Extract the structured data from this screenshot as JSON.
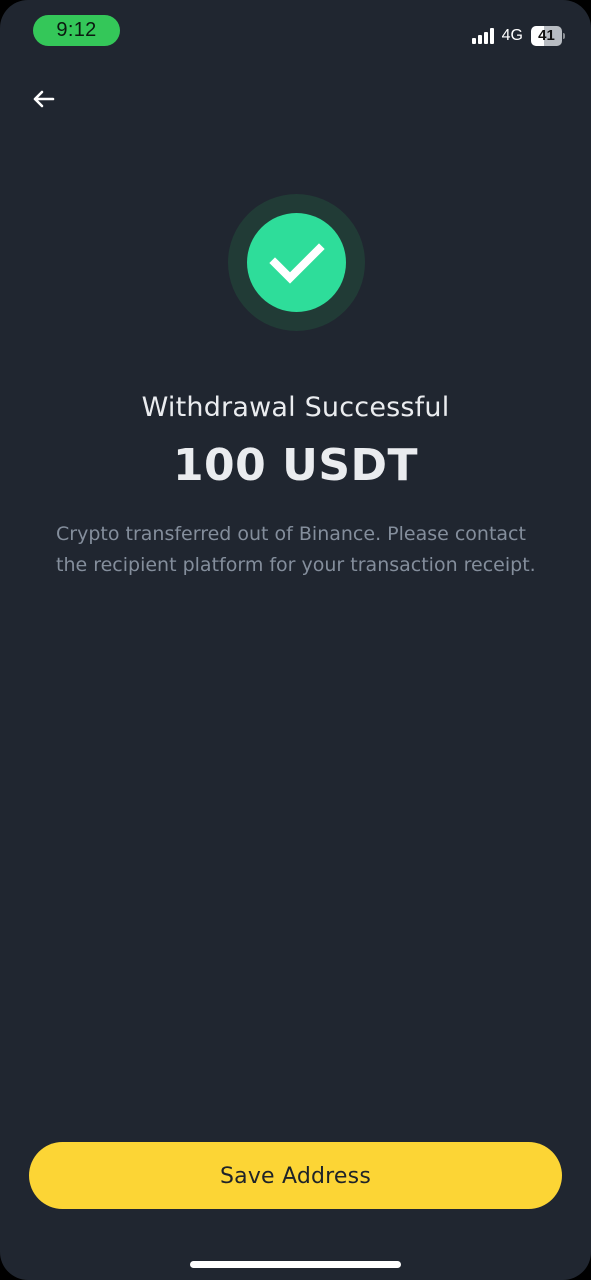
{
  "status_bar": {
    "time": "9:12",
    "network": "4G",
    "battery": "41",
    "battery_level": 0.41,
    "time_pill_color": "#34c759"
  },
  "nav": {
    "back_icon": "arrow-left-icon"
  },
  "result": {
    "icon": "checkmark-icon",
    "title": "Withdrawal Successful",
    "amount": "100 USDT",
    "description": "Crypto transferred out of Binance. Please contact the recipient platform for your transaction receipt.",
    "success_color": "#2edd9a"
  },
  "actions": {
    "save_address_label": "Save Address",
    "button_color": "#fcd535"
  },
  "theme": {
    "background": "#202630"
  }
}
